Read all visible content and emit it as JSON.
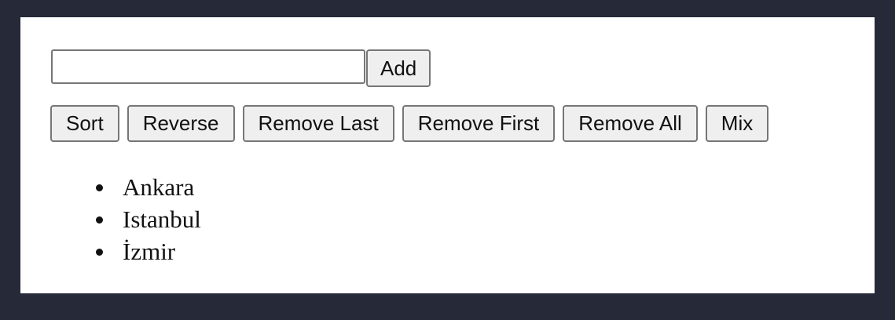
{
  "form": {
    "input_value": "",
    "input_placeholder": "",
    "add_label": "Add"
  },
  "actions": [
    {
      "label": "Sort"
    },
    {
      "label": "Reverse"
    },
    {
      "label": "Remove Last"
    },
    {
      "label": "Remove First"
    },
    {
      "label": "Remove All"
    },
    {
      "label": "Mix"
    }
  ],
  "cities": [
    "Ankara",
    "Istanbul",
    "İzmir"
  ]
}
